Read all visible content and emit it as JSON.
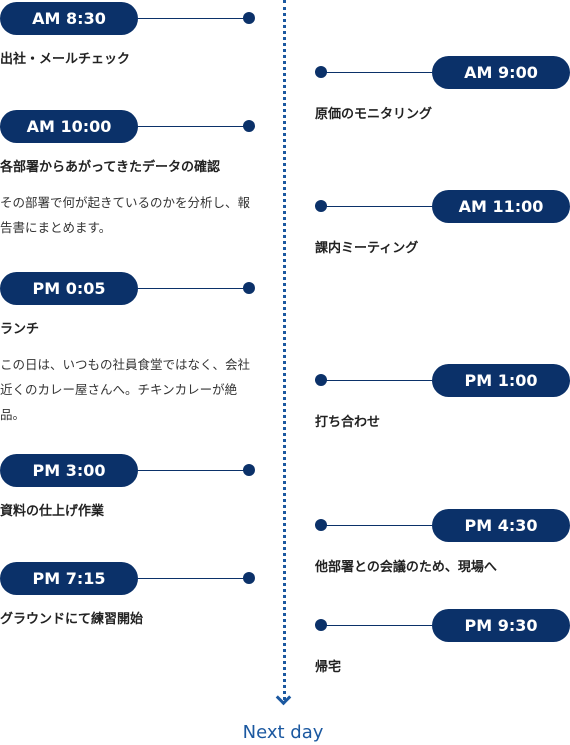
{
  "colors": {
    "pill": "#0b3169",
    "timeline": "#1b58a0"
  },
  "left": [
    {
      "time": "AM 8:30",
      "title": "出社・メールチェック",
      "desc": ""
    },
    {
      "time": "AM 10:00",
      "title": "各部署からあがってきたデータの確認",
      "desc": "その部署で何が起きているのかを分析し、報告書にまとめます。"
    },
    {
      "time": "PM 0:05",
      "title": "ランチ",
      "desc": "この日は、いつもの社員食堂ではなく、会社近くのカレー屋さんへ。チキンカレーが絶品。"
    },
    {
      "time": "PM 3:00",
      "title": "資料の仕上げ作業",
      "desc": ""
    },
    {
      "time": "PM 7:15",
      "title": "グラウンドにて練習開始",
      "desc": ""
    }
  ],
  "right": [
    {
      "time": "AM 9:00",
      "title": "原価のモニタリング"
    },
    {
      "time": "AM 11:00",
      "title": "課内ミーティング"
    },
    {
      "time": "PM 1:00",
      "title": "打ち合わせ"
    },
    {
      "time": "PM 4:30",
      "title": "他部署との会議のため、現場へ"
    },
    {
      "time": "PM 9:30",
      "title": "帰宅"
    }
  ],
  "next_day": "Next day"
}
